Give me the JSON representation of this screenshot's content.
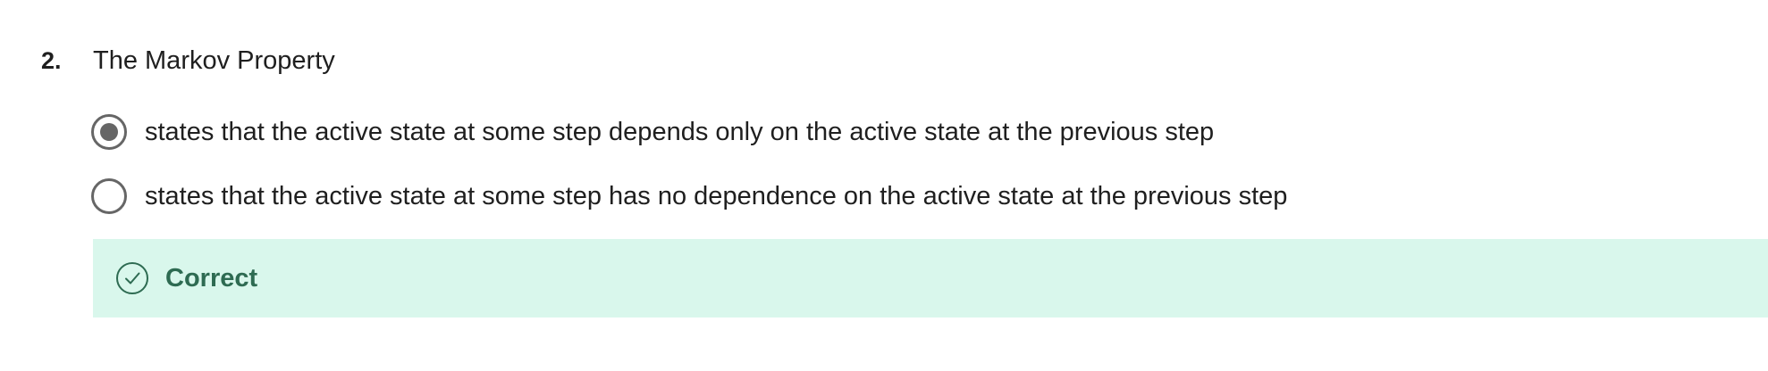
{
  "question": {
    "number": "2.",
    "title": "The Markov Property",
    "options": [
      {
        "label": "states that the active state at some step depends only on the active state at the previous step",
        "selected": true
      },
      {
        "label": "states that the active state at some step has no dependence on the active state at the previous step",
        "selected": false
      }
    ]
  },
  "feedback": {
    "label": "Correct",
    "icon": "check-circle-icon",
    "background_color": "#d9f7ec",
    "text_color": "#2e6b52"
  },
  "colors": {
    "radio_border": "#666666",
    "text": "#1f1f1f"
  }
}
